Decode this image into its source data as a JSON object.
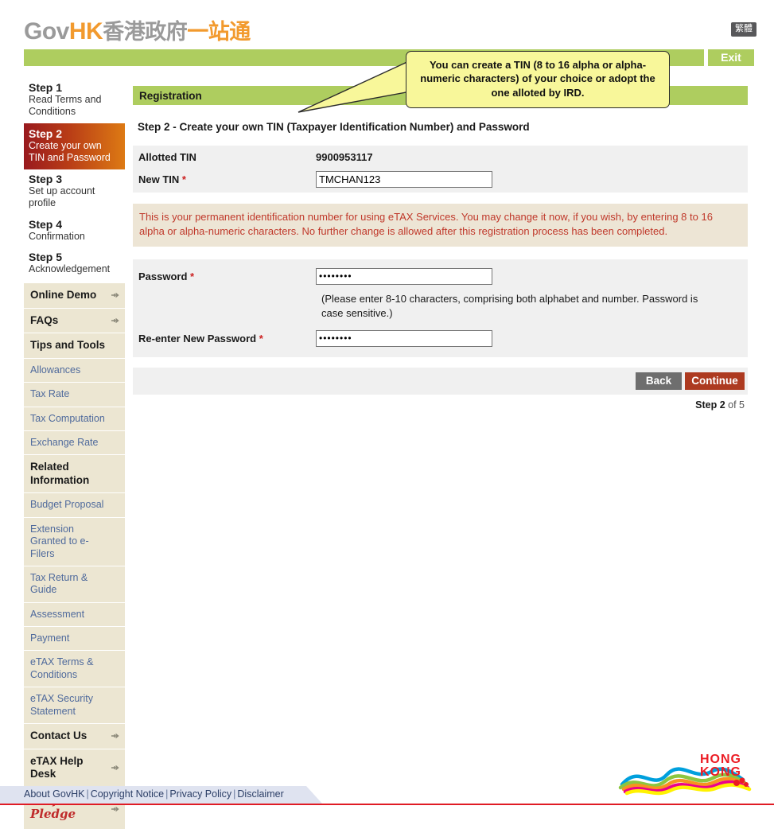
{
  "header": {
    "logo": {
      "gov": "Gov",
      "hk": "HK",
      "cn_gray": "香港政府",
      "cn_orange": "一站通"
    },
    "lang_toggle": "繁體",
    "exit_label": "Exit"
  },
  "sidebar": {
    "steps": [
      {
        "title": "Step 1",
        "sub": "Read Terms and Conditions",
        "active": false
      },
      {
        "title": "Step 2",
        "sub": "Create your own TIN and Password",
        "active": true
      },
      {
        "title": "Step 3",
        "sub": "Set up account profile",
        "active": false
      },
      {
        "title": "Step 4",
        "sub": "Confirmation",
        "active": false
      },
      {
        "title": "Step 5",
        "sub": "Acknowledgement",
        "active": false
      }
    ],
    "menu": [
      {
        "label": "Online Demo",
        "type": "head",
        "arrow": true
      },
      {
        "label": "FAQs",
        "type": "head",
        "arrow": true
      },
      {
        "label": "Tips and Tools",
        "type": "head",
        "arrow": false
      },
      {
        "label": "Allowances",
        "type": "link",
        "arrow": false
      },
      {
        "label": "Tax Rate",
        "type": "link",
        "arrow": false
      },
      {
        "label": "Tax Computation",
        "type": "link",
        "arrow": false
      },
      {
        "label": "Exchange Rate",
        "type": "link",
        "arrow": false
      },
      {
        "label": "Related Information",
        "type": "head",
        "arrow": false
      },
      {
        "label": "Budget Proposal",
        "type": "link",
        "arrow": false
      },
      {
        "label": "Extension Granted to e-Filers",
        "type": "link",
        "arrow": false
      },
      {
        "label": "Tax Return & Guide",
        "type": "link",
        "arrow": false
      },
      {
        "label": "Assessment",
        "type": "link",
        "arrow": false
      },
      {
        "label": "Payment",
        "type": "link",
        "arrow": false
      },
      {
        "label": "eTAX Terms & Conditions",
        "type": "link",
        "arrow": false
      },
      {
        "label": "eTAX Security Statement",
        "type": "link",
        "arrow": false
      },
      {
        "label": "Contact Us",
        "type": "head",
        "arrow": true
      },
      {
        "label": "eTAX Help Desk",
        "type": "head",
        "arrow": true
      },
      {
        "label": "Performance Pledge",
        "type": "pledge",
        "arrow": true
      }
    ]
  },
  "main": {
    "section_bar": "Registration",
    "page_heading": "Step 2 - Create your own TIN (Taxpayer Identification Number) and Password",
    "allotted_tin_label": "Allotted TIN",
    "allotted_tin_value": "9900953117",
    "new_tin_label": "New TIN",
    "new_tin_value": "TMCHAN123",
    "new_tin_placeholder": "",
    "notice": "This is your permanent identification number for using eTAX Services. You may change it now, if you wish, by entering 8 to 16 alpha or alpha-numeric characters. No further change is allowed after this registration process has been completed.",
    "password_label": "Password",
    "password_value": "••••••••",
    "password_hint": "(Please enter 8-10 characters, comprising both alphabet and number. Password is case sensitive.)",
    "repassword_label": "Re-enter New Password",
    "repassword_value": "••••••••",
    "required_marker": "*",
    "back_label": "Back",
    "continue_label": "Continue",
    "step_counter_bold": "Step 2",
    "step_counter_rest": " of 5"
  },
  "tooltip": {
    "text": "You can create a TIN (8 to 16 alpha or alpha-numeric characters) of your choice or adopt the one alloted by IRD."
  },
  "footer": {
    "links": [
      "About GovHK",
      "Copyright Notice",
      "Privacy Policy",
      "Disclaimer"
    ],
    "separator": "|"
  },
  "brand": {
    "hk_line1": "HONG",
    "hk_line2": "KONG"
  },
  "colors": {
    "green": "#aecd5f",
    "orange": "#f29a2e",
    "beige": "#ece6d2",
    "notice_red": "#c0392b",
    "continue_red": "#ad3a20",
    "link_blue": "#4f6a9c"
  }
}
